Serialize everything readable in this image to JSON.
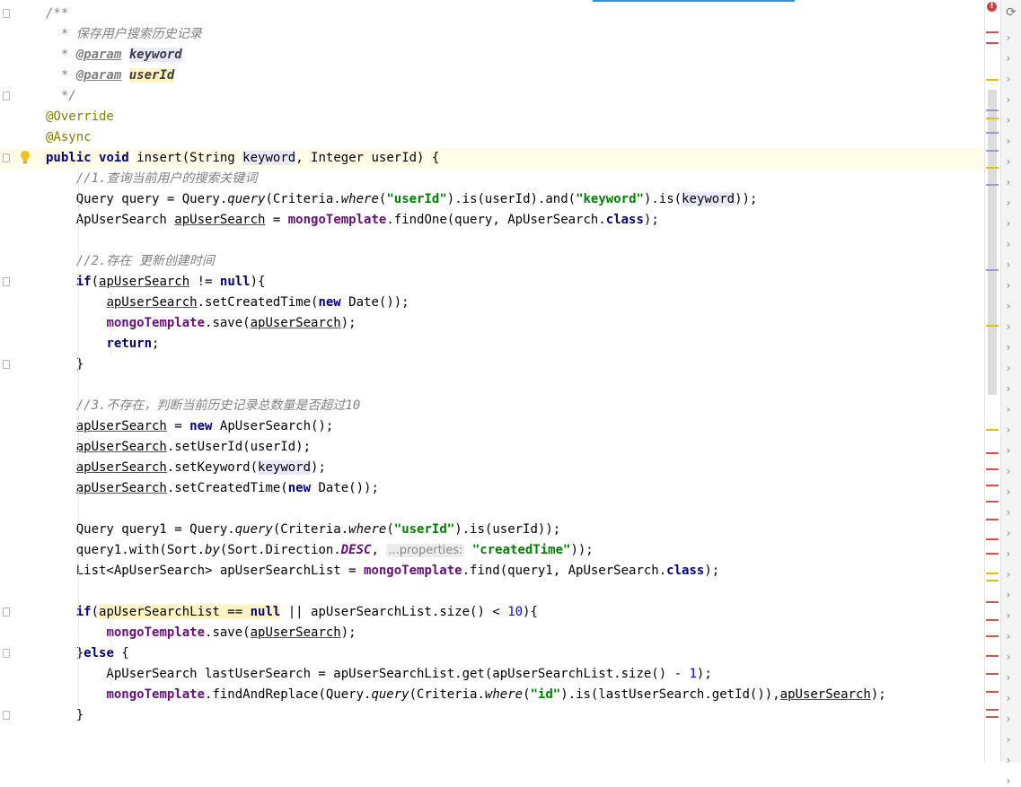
{
  "editor": {
    "language": "java",
    "highlighted_line": 8,
    "lines": [
      [
        {
          "t": "/**",
          "c": "doc"
        }
      ],
      [
        {
          "t": "  * 保存用户搜索历史记录",
          "c": "doc"
        }
      ],
      [
        {
          "t": "  * ",
          "c": "doc"
        },
        {
          "t": "@param",
          "c": "tag"
        },
        {
          "t": " ",
          "c": "doc"
        },
        {
          "t": "keyword",
          "c": "pn hp"
        }
      ],
      [
        {
          "t": "  * ",
          "c": "doc"
        },
        {
          "t": "@param",
          "c": "tag"
        },
        {
          "t": " ",
          "c": "doc"
        },
        {
          "t": "userId",
          "c": "pn hy"
        }
      ],
      [
        {
          "t": "  */",
          "c": "doc"
        }
      ],
      [
        {
          "t": "@Override",
          "c": "ann"
        }
      ],
      [
        {
          "t": "@Async",
          "c": "ann"
        }
      ],
      [
        {
          "t": "public",
          "c": "kw"
        },
        {
          "t": " "
        },
        {
          "t": "void",
          "c": "kw"
        },
        {
          "t": " insert(String "
        },
        {
          "t": "keyword",
          "c": "hp"
        },
        {
          "t": ", Integer userId) {"
        }
      ],
      [
        {
          "t": "    //1.查询当前用户的搜索关键词",
          "c": "cmt"
        }
      ],
      [
        {
          "t": "    Query query = Query."
        },
        {
          "t": "query",
          "c": "st"
        },
        {
          "t": "(Criteria."
        },
        {
          "t": "where",
          "c": "st"
        },
        {
          "t": "("
        },
        {
          "t": "\"userId\"",
          "c": "str"
        },
        {
          "t": ").is(userId).and("
        },
        {
          "t": "\"keyword\"",
          "c": "str"
        },
        {
          "t": ").is("
        },
        {
          "t": "keyword",
          "c": "hp"
        },
        {
          "t": "));"
        }
      ],
      [
        {
          "t": "    ApUserSearch "
        },
        {
          "t": "apUserSearch",
          "c": "ul"
        },
        {
          "t": " = "
        },
        {
          "t": "mongoTemplate",
          "c": "fld"
        },
        {
          "t": ".findOne(query, ApUserSearch."
        },
        {
          "t": "class",
          "c": "kw"
        },
        {
          "t": ");"
        }
      ],
      [],
      [
        {
          "t": "    //2.存在 更新创建时间",
          "c": "cmt"
        }
      ],
      [
        {
          "t": "    "
        },
        {
          "t": "if",
          "c": "kw"
        },
        {
          "t": "("
        },
        {
          "t": "apUserSearch",
          "c": "ul"
        },
        {
          "t": " != "
        },
        {
          "t": "null",
          "c": "kw"
        },
        {
          "t": "){"
        }
      ],
      [
        {
          "t": "        "
        },
        {
          "t": "apUserSearch",
          "c": "ul"
        },
        {
          "t": ".setCreatedTime("
        },
        {
          "t": "new",
          "c": "kw"
        },
        {
          "t": " Date());"
        }
      ],
      [
        {
          "t": "        "
        },
        {
          "t": "mongoTemplate",
          "c": "fld"
        },
        {
          "t": ".save("
        },
        {
          "t": "apUserSearch",
          "c": "ul"
        },
        {
          "t": ");"
        }
      ],
      [
        {
          "t": "        "
        },
        {
          "t": "return",
          "c": "kw"
        },
        {
          "t": ";"
        }
      ],
      [
        {
          "t": "    }"
        }
      ],
      [],
      [
        {
          "t": "    //3.不存在，判断当前历史记录总数量是否超过10",
          "c": "cmt"
        }
      ],
      [
        {
          "t": "    "
        },
        {
          "t": "apUserSearch",
          "c": "ul"
        },
        {
          "t": " = "
        },
        {
          "t": "new",
          "c": "kw"
        },
        {
          "t": " ApUserSearch();"
        }
      ],
      [
        {
          "t": "    "
        },
        {
          "t": "apUserSearch",
          "c": "ul"
        },
        {
          "t": ".setUserId(userId);"
        }
      ],
      [
        {
          "t": "    "
        },
        {
          "t": "apUserSearch",
          "c": "ul"
        },
        {
          "t": ".setKeyword("
        },
        {
          "t": "keyword",
          "c": "hp"
        },
        {
          "t": ");"
        }
      ],
      [
        {
          "t": "    "
        },
        {
          "t": "apUserSearch",
          "c": "ul"
        },
        {
          "t": ".setCreatedTime("
        },
        {
          "t": "new",
          "c": "kw"
        },
        {
          "t": " Date());"
        }
      ],
      [],
      [
        {
          "t": "    Query query1 = Query."
        },
        {
          "t": "query",
          "c": "st"
        },
        {
          "t": "(Criteria."
        },
        {
          "t": "where",
          "c": "st"
        },
        {
          "t": "("
        },
        {
          "t": "\"userId\"",
          "c": "str"
        },
        {
          "t": ").is(userId));"
        }
      ],
      [
        {
          "t": "    query1.with(Sort."
        },
        {
          "t": "by",
          "c": "st"
        },
        {
          "t": "(Sort.Direction."
        },
        {
          "t": "DESC",
          "c": "stf"
        },
        {
          "t": ", "
        },
        {
          "t": "...properties:",
          "c": "hint"
        },
        {
          "t": " "
        },
        {
          "t": "\"createdTime\"",
          "c": "str"
        },
        {
          "t": "));"
        }
      ],
      [
        {
          "t": "    List<ApUserSearch> apUserSearchList = "
        },
        {
          "t": "mongoTemplate",
          "c": "fld"
        },
        {
          "t": ".find(query1, ApUserSearch."
        },
        {
          "t": "class",
          "c": "kw"
        },
        {
          "t": ");"
        }
      ],
      [],
      [
        {
          "t": "    "
        },
        {
          "t": "if",
          "c": "kw"
        },
        {
          "t": "("
        },
        {
          "t": "apUserSearchList == ",
          "c": "hy"
        },
        {
          "t": "null",
          "c": "kw hy"
        },
        {
          "t": " || apUserSearchList.size() < "
        },
        {
          "t": "10",
          "c": "num"
        },
        {
          "t": "){"
        }
      ],
      [
        {
          "t": "        "
        },
        {
          "t": "mongoTemplate",
          "c": "fld"
        },
        {
          "t": ".save("
        },
        {
          "t": "apUserSearch",
          "c": "ul"
        },
        {
          "t": ");"
        }
      ],
      [
        {
          "t": "    }"
        },
        {
          "t": "else",
          "c": "kw"
        },
        {
          "t": " {"
        }
      ],
      [
        {
          "t": "        ApUserSearch lastUserSearch = apUserSearchList.get(apUserSearchList.size() - "
        },
        {
          "t": "1",
          "c": "num"
        },
        {
          "t": ");"
        }
      ],
      [
        {
          "t": "        "
        },
        {
          "t": "mongoTemplate",
          "c": "fld"
        },
        {
          "t": ".findAndReplace(Query."
        },
        {
          "t": "query",
          "c": "st"
        },
        {
          "t": "(Criteria."
        },
        {
          "t": "where",
          "c": "st"
        },
        {
          "t": "("
        },
        {
          "t": "\"id\"",
          "c": "str"
        },
        {
          "t": ").is(lastUserSearch.getId()),"
        },
        {
          "t": "apUserSearch",
          "c": "ul"
        },
        {
          "t": ");"
        }
      ],
      [
        {
          "t": "    }"
        }
      ]
    ],
    "fold_markers": [
      1,
      5,
      8,
      14,
      18,
      30,
      32,
      35
    ],
    "bulb_line": 8,
    "bulb_icon": "lightbulb-icon"
  },
  "gutter_markers": {
    "error_icon": "error-icon",
    "error_text": "!",
    "colors": {
      "error": "#d25252",
      "warning": "#e0c000",
      "info": "#9a9ad8"
    }
  },
  "right_panel": {
    "refresh_icon": "refresh-icon",
    "refresh_glyph": "⟳",
    "chevron_glyph": "›",
    "chevron_count": 37
  }
}
